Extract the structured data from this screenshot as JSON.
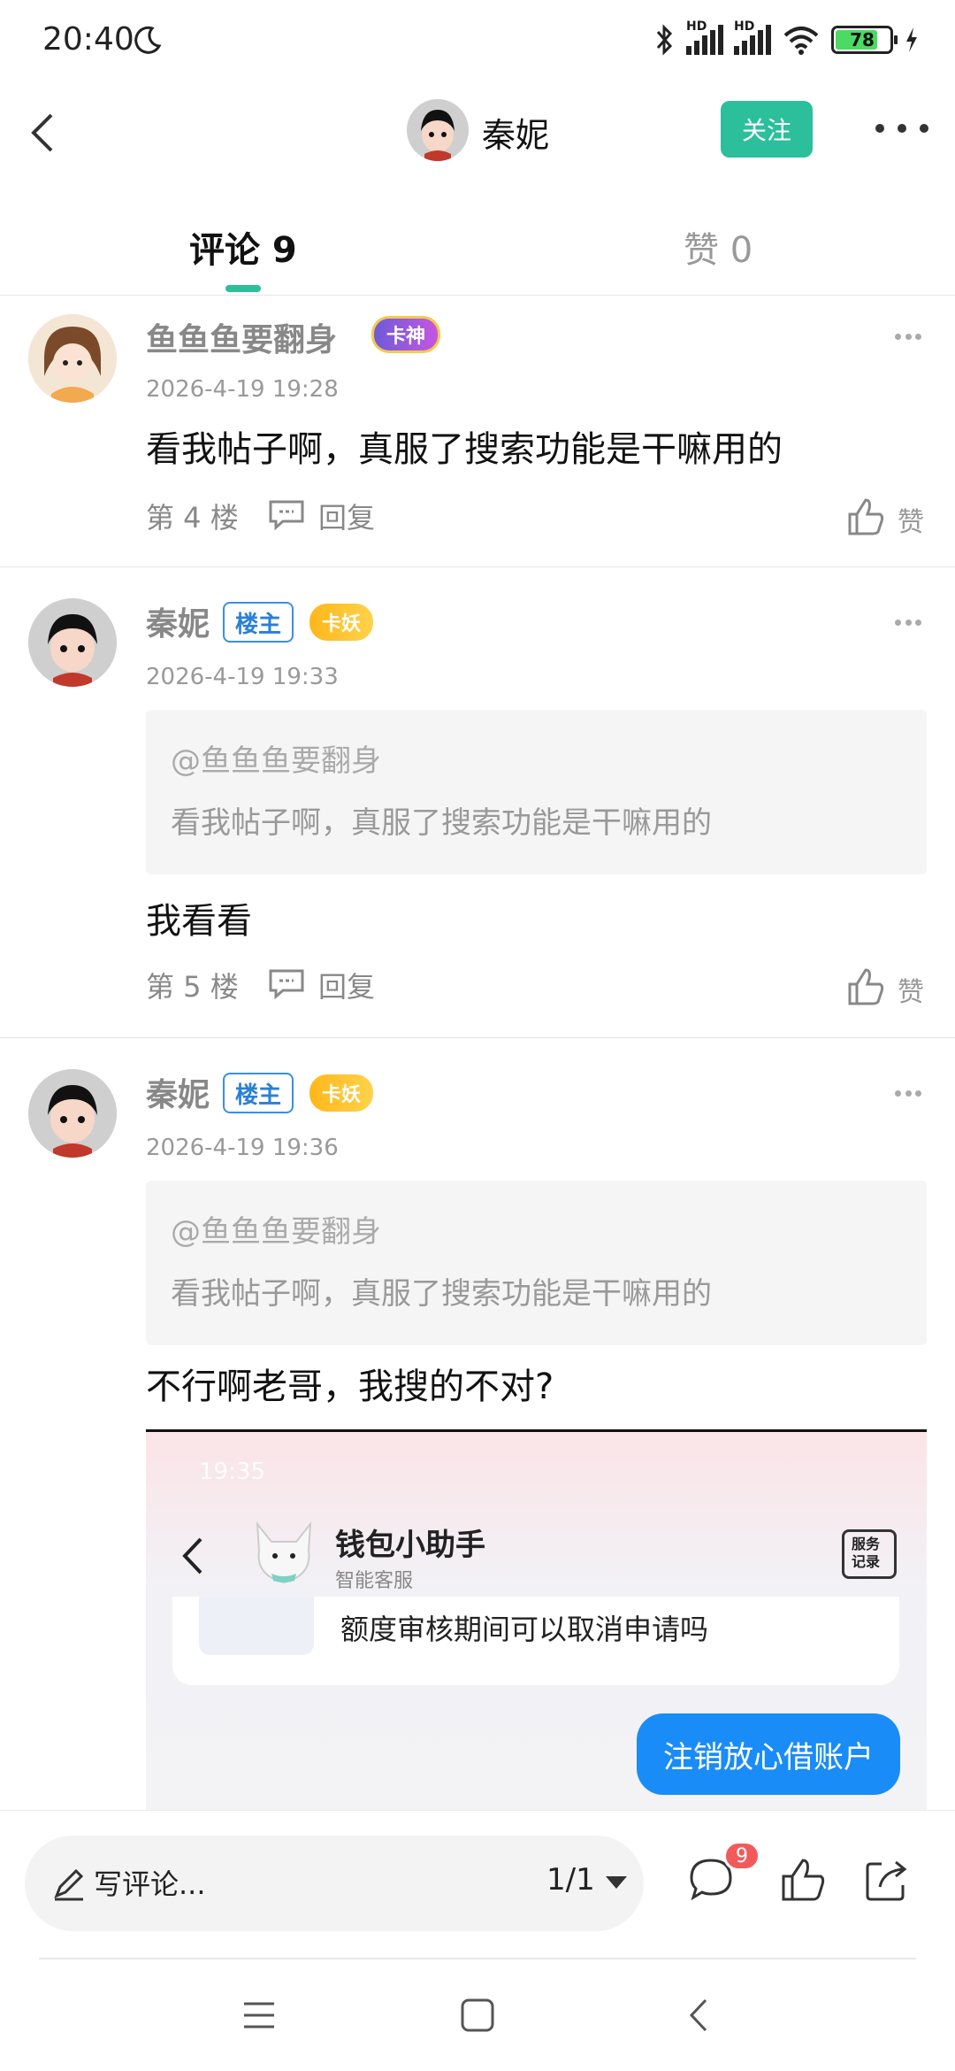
{
  "status_bar": {
    "time": "20:40",
    "battery": "78",
    "network_1": "HD",
    "network_2": "HD"
  },
  "header": {
    "name": "秦妮",
    "follow_label": "关注"
  },
  "tabs": {
    "comments": "评论 9",
    "likes": "赞 0"
  },
  "comments": [
    {
      "user": "鱼鱼鱼要翻身",
      "rank": "卡神",
      "time": "2026-4-19 19:28",
      "text": "看我帖子啊，真服了搜索功能是干嘛用的",
      "floor": "第 4 楼",
      "reply": "回复",
      "like": "赞"
    },
    {
      "user": "秦妮",
      "op_badge": "楼主",
      "rank": "卡妖",
      "time": "2026-4-19 19:33",
      "quote_user": "@鱼鱼鱼要翻身",
      "quote_text": "看我帖子啊，真服了搜索功能是干嘛用的",
      "text": "我看看",
      "floor": "第 5 楼",
      "reply": "回复",
      "like": "赞"
    },
    {
      "user": "秦妮",
      "op_badge": "楼主",
      "rank": "卡妖",
      "time": "2026-4-19 19:36",
      "quote_user": "@鱼鱼鱼要翻身",
      "quote_text": "看我帖子啊，真服了搜索功能是干嘛用的",
      "text": "不行啊老哥，我搜的不对?"
    }
  ],
  "embedded_screenshot": {
    "time": "19:35",
    "title": "钱包小助手",
    "subtitle": "智能客服",
    "record_label": "服务\n记录",
    "card_text": "额度审核期间可以取消申请吗",
    "bubble_text": "注销放心借账户"
  },
  "bottom_bar": {
    "input_placeholder": "写评论...",
    "page_indicator": "1/1",
    "comment_count": "9"
  },
  "colors": {
    "accent": "#2bbf9c",
    "op_blue": "#3a8ee6",
    "badge_red": "#f25a5a",
    "bubble_blue": "#1a8cf7"
  }
}
